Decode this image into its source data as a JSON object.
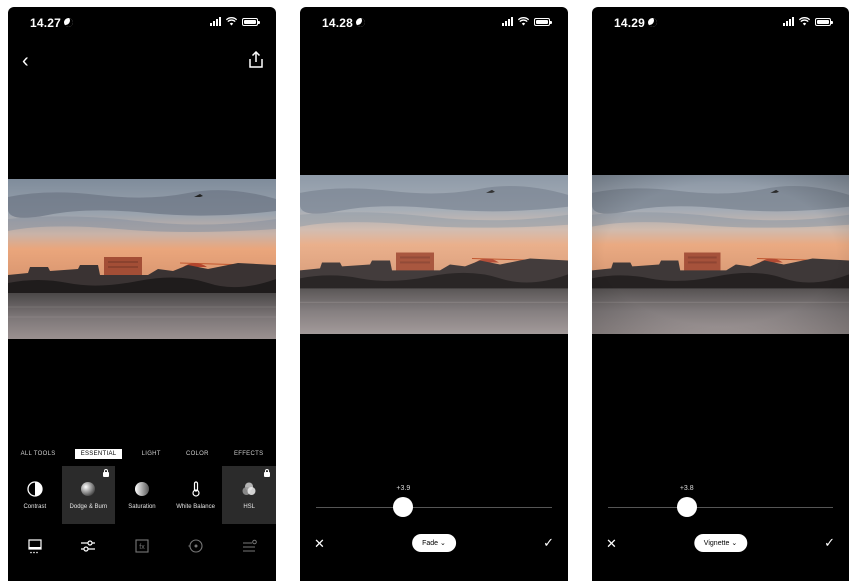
{
  "screens": [
    {
      "time": "14.27",
      "nav": {
        "back_icon": "chevron-left-icon",
        "share_icon": "share-icon"
      },
      "tabs": [
        {
          "label": "ALL TOOLS",
          "active": false
        },
        {
          "label": "ESSENTIAL",
          "active": true
        },
        {
          "label": "LIGHT",
          "active": false
        },
        {
          "label": "COLOR",
          "active": false
        },
        {
          "label": "EFFECTS",
          "active": false
        }
      ],
      "tools": [
        {
          "label": "Contrast",
          "icon": "contrast-icon",
          "locked": false,
          "selected": false
        },
        {
          "label": "Dodge & Burn",
          "icon": "dodge-burn-icon",
          "locked": true,
          "selected": true
        },
        {
          "label": "Saturation",
          "icon": "saturation-icon",
          "locked": false,
          "selected": false
        },
        {
          "label": "White Balance",
          "icon": "thermometer-icon",
          "locked": false,
          "selected": false
        },
        {
          "label": "HSL",
          "icon": "hsl-icon",
          "locked": true,
          "selected": true
        }
      ],
      "bottom_icons": [
        "presets-icon",
        "adjust-icon",
        "fx-icon",
        "history-icon",
        "layers-icon"
      ]
    },
    {
      "time": "14.28",
      "slider": {
        "value_label": "+3.9",
        "position": 0.37
      },
      "tool_pill": "Fade",
      "cancel_icon": "close-icon",
      "confirm_icon": "check-icon"
    },
    {
      "time": "14.29",
      "slider": {
        "value_label": "+3.8",
        "position": 0.35
      },
      "tool_pill": "Vignette",
      "cancel_icon": "close-icon",
      "confirm_icon": "check-icon"
    }
  ],
  "colors": {
    "background": "#000000",
    "sky_top": "#8e9aa8",
    "sky_glow": "#e8a77a",
    "building": "#b4553a",
    "water": "#6e6a6c"
  }
}
